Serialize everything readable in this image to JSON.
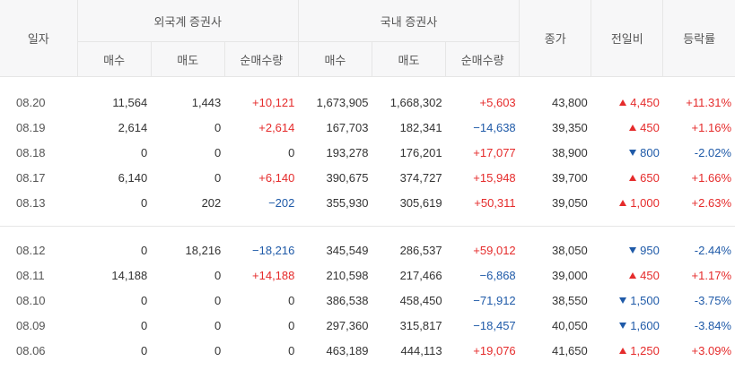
{
  "headers": {
    "date": "일자",
    "foreign_group": "외국계 증권사",
    "domestic_group": "국내 증권사",
    "buy": "매수",
    "sell": "매도",
    "net": "순매수량",
    "close": "종가",
    "change": "전일비",
    "rate": "등락률"
  },
  "colors": {
    "up": "#e52b2b",
    "down": "#1f5aa8",
    "header_bg": "#f7f7f8",
    "border": "#e6e6e6"
  },
  "rows": [
    {
      "date": "08.20",
      "f_buy": "11,564",
      "f_sell": "1,443",
      "f_net": "+10,121",
      "f_net_dir": "up",
      "d_buy": "1,673,905",
      "d_sell": "1,668,302",
      "d_net": "+5,603",
      "d_net_dir": "up",
      "close": "43,800",
      "change": "4,450",
      "change_dir": "up",
      "rate": "+11.31%",
      "rate_dir": "up"
    },
    {
      "date": "08.19",
      "f_buy": "2,614",
      "f_sell": "0",
      "f_net": "+2,614",
      "f_net_dir": "up",
      "d_buy": "167,703",
      "d_sell": "182,341",
      "d_net": "−14,638",
      "d_net_dir": "down",
      "close": "39,350",
      "change": "450",
      "change_dir": "up",
      "rate": "+1.16%",
      "rate_dir": "up"
    },
    {
      "date": "08.18",
      "f_buy": "0",
      "f_sell": "0",
      "f_net": "0",
      "f_net_dir": "none",
      "d_buy": "193,278",
      "d_sell": "176,201",
      "d_net": "+17,077",
      "d_net_dir": "up",
      "close": "38,900",
      "change": "800",
      "change_dir": "down",
      "rate": "-2.02%",
      "rate_dir": "down"
    },
    {
      "date": "08.17",
      "f_buy": "6,140",
      "f_sell": "0",
      "f_net": "+6,140",
      "f_net_dir": "up",
      "d_buy": "390,675",
      "d_sell": "374,727",
      "d_net": "+15,948",
      "d_net_dir": "up",
      "close": "39,700",
      "change": "650",
      "change_dir": "up",
      "rate": "+1.66%",
      "rate_dir": "up"
    },
    {
      "date": "08.13",
      "f_buy": "0",
      "f_sell": "202",
      "f_net": "−202",
      "f_net_dir": "down",
      "d_buy": "355,930",
      "d_sell": "305,619",
      "d_net": "+50,311",
      "d_net_dir": "up",
      "close": "39,050",
      "change": "1,000",
      "change_dir": "up",
      "rate": "+2.63%",
      "rate_dir": "up"
    },
    {
      "date": "08.12",
      "f_buy": "0",
      "f_sell": "18,216",
      "f_net": "−18,216",
      "f_net_dir": "down",
      "d_buy": "345,549",
      "d_sell": "286,537",
      "d_net": "+59,012",
      "d_net_dir": "up",
      "close": "38,050",
      "change": "950",
      "change_dir": "down",
      "rate": "-2.44%",
      "rate_dir": "down"
    },
    {
      "date": "08.11",
      "f_buy": "14,188",
      "f_sell": "0",
      "f_net": "+14,188",
      "f_net_dir": "up",
      "d_buy": "210,598",
      "d_sell": "217,466",
      "d_net": "−6,868",
      "d_net_dir": "down",
      "close": "39,000",
      "change": "450",
      "change_dir": "up",
      "rate": "+1.17%",
      "rate_dir": "up"
    },
    {
      "date": "08.10",
      "f_buy": "0",
      "f_sell": "0",
      "f_net": "0",
      "f_net_dir": "none",
      "d_buy": "386,538",
      "d_sell": "458,450",
      "d_net": "−71,912",
      "d_net_dir": "down",
      "close": "38,550",
      "change": "1,500",
      "change_dir": "down",
      "rate": "-3.75%",
      "rate_dir": "down"
    },
    {
      "date": "08.09",
      "f_buy": "0",
      "f_sell": "0",
      "f_net": "0",
      "f_net_dir": "none",
      "d_buy": "297,360",
      "d_sell": "315,817",
      "d_net": "−18,457",
      "d_net_dir": "down",
      "close": "40,050",
      "change": "1,600",
      "change_dir": "down",
      "rate": "-3.84%",
      "rate_dir": "down"
    },
    {
      "date": "08.06",
      "f_buy": "0",
      "f_sell": "0",
      "f_net": "0",
      "f_net_dir": "none",
      "d_buy": "463,189",
      "d_sell": "444,113",
      "d_net": "+19,076",
      "d_net_dir": "up",
      "close": "41,650",
      "change": "1,250",
      "change_dir": "up",
      "rate": "+3.09%",
      "rate_dir": "up"
    }
  ]
}
